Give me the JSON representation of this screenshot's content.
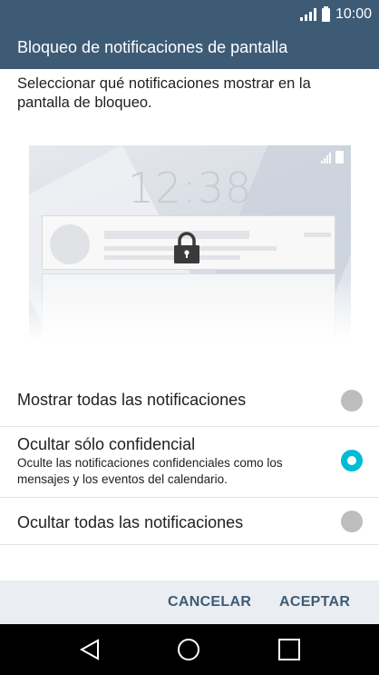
{
  "status_bar": {
    "time": "10:00"
  },
  "app_bar": {
    "title": "Bloqueo de notificaciones de pantalla"
  },
  "description": "Seleccionar qué notificaciones mostrar en la pantalla de bloqueo.",
  "preview": {
    "lock_time": "12:38"
  },
  "options": [
    {
      "label": "Mostrar todas las notificaciones",
      "subtitle": "",
      "selected": false
    },
    {
      "label": "Ocultar sólo confidencial",
      "subtitle": "Oculte las notificaciones confidenciales como los mensajes y los eventos del calendario.",
      "selected": true
    },
    {
      "label": "Ocultar todas las notificaciones",
      "subtitle": "",
      "selected": false
    }
  ],
  "actions": {
    "cancel_label": "CANCELAR",
    "accept_label": "ACEPTAR"
  },
  "colors": {
    "primary": "#3e5b76",
    "accent": "#00bcd4",
    "radio_off": "#bdbdbd"
  },
  "icons": [
    "signal-icon",
    "battery-icon",
    "lock-icon",
    "back-icon",
    "home-icon",
    "recents-icon"
  ]
}
